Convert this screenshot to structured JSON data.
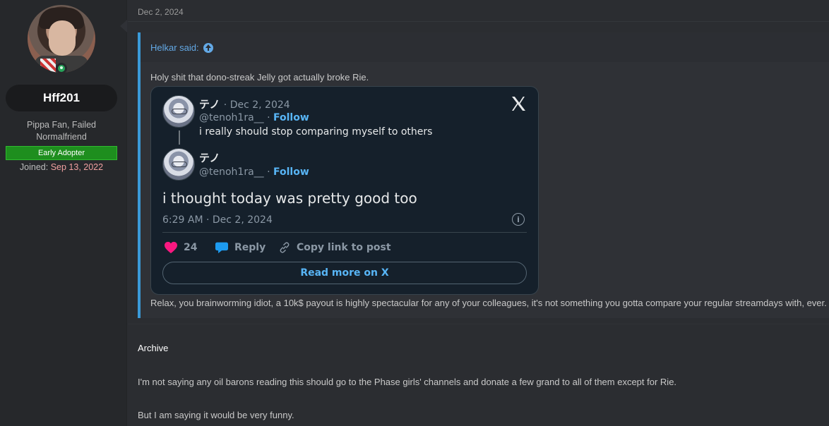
{
  "user": {
    "username": "Hff201",
    "title": "Pippa Fan, Failed Normalfriend",
    "banner": "Early Adopter",
    "joined_label": "Joined:",
    "joined_date": "Sep 13, 2022",
    "online": true
  },
  "post": {
    "date": "Dec 2, 2024",
    "quote": {
      "author": "Helkar said:",
      "line1": "Holy shit that dono-streak Jelly got actually broke Rie.",
      "line2": "Relax, you brainworming idiot, a 10k$ payout is highly spectacular for any of your colleagues, it's not something you gotta compare your regular streamdays with, ever."
    },
    "archive_label": "Archive",
    "body_line1": "I'm not saying any oil barons reading this should go to the Phase girls' channels and donate a few grand to all of them except for Rie.",
    "body_line2": "But I am saying it would be very funny."
  },
  "tweet": {
    "parent": {
      "name": "テノ",
      "meta": "· Dec 2, 2024",
      "handle": "@tenoh1ra__",
      "sep": "·",
      "follow": "Follow",
      "text": "i really should stop comparing myself to others"
    },
    "main": {
      "name": "テノ",
      "handle": "@tenoh1ra__",
      "sep": "·",
      "follow": "Follow",
      "text": "i thought today was pretty good too",
      "time": "6:29 AM · Dec 2, 2024"
    },
    "actions": {
      "likes": "24",
      "reply": "Reply",
      "copy": "Copy link to post"
    },
    "read_more": "Read more on X",
    "colors": {
      "background": "#15202b",
      "link": "#58b5f6",
      "heart": "#f91880"
    }
  }
}
